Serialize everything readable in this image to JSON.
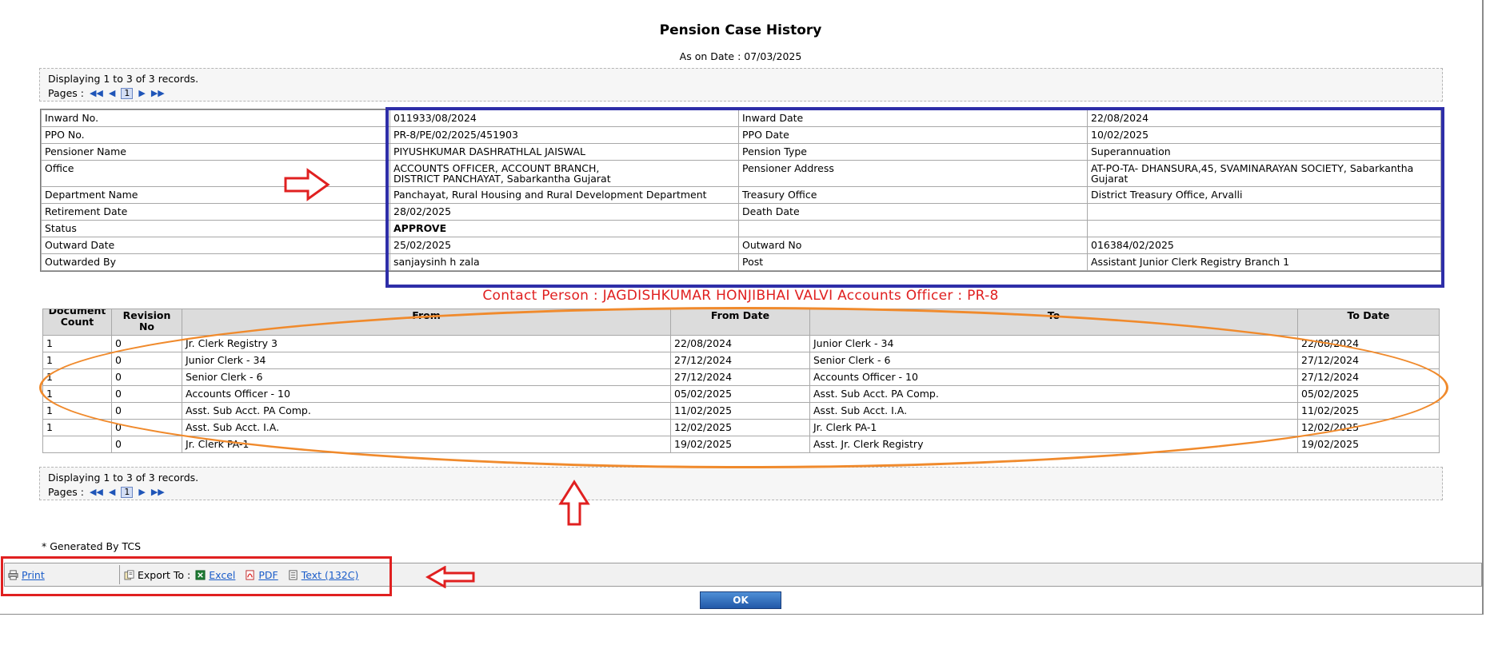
{
  "title": "Pension Case History",
  "as_on_date": "As on Date : 07/03/2025",
  "pager": {
    "records_text": "Displaying 1 to 3 of 3 records.",
    "pages_label": "Pages :",
    "current_page": "1"
  },
  "info_rows": [
    {
      "label1": "Inward No.",
      "value1": "011933/08/2024",
      "label2": "Inward Date",
      "value2": "22/08/2024"
    },
    {
      "label1": "PPO No.",
      "value1": "PR-8/PE/02/2025/451903",
      "label2": "PPO Date",
      "value2": "10/02/2025"
    },
    {
      "label1": "Pensioner Name",
      "value1": "PIYUSHKUMAR DASHRATHLAL JAISWAL",
      "label2": "Pension Type",
      "value2": "Superannuation"
    },
    {
      "label1": "Office",
      "value1": "ACCOUNTS OFFICER, ACCOUNT BRANCH,\nDISTRICT PANCHAYAT, Sabarkantha Gujarat",
      "label2": "Pensioner Address",
      "value2": "AT-PO-TA- DHANSURA,45, SVAMINARAYAN SOCIETY, Sabarkantha\nGujarat"
    },
    {
      "label1": "Department Name",
      "value1": "Panchayat, Rural Housing and Rural Development Department",
      "label2": "Treasury Office",
      "value2": "District Treasury Office, Arvalli"
    },
    {
      "label1": "Retirement Date",
      "value1": "28/02/2025",
      "label2": "Death Date",
      "value2": ""
    },
    {
      "label1": "Status",
      "value1": "APPROVE",
      "label2": "",
      "value2": ""
    },
    {
      "label1": "Outward Date",
      "value1": "25/02/2025",
      "label2": "Outward No",
      "value2": "016384/02/2025"
    },
    {
      "label1": "Outwarded By",
      "value1": "sanjaysinh h zala",
      "label2": "Post",
      "value2": "Assistant Junior Clerk Registry Branch 1"
    }
  ],
  "contact_person": "Contact Person : JAGDISHKUMAR HONJIBHAI VALVI Accounts Officer : PR-8",
  "doc_headers": {
    "count_line1": "Document",
    "count_line2": "Count",
    "revision": "Revision No",
    "from": "From",
    "from_date": "From Date",
    "to": "To",
    "to_date": "To Date"
  },
  "doc_rows": [
    {
      "count": "1",
      "rev": "0",
      "from": "Jr. Clerk Registry 3",
      "from_date": "22/08/2024",
      "to": "Junior Clerk - 34",
      "to_date": "22/08/2024"
    },
    {
      "count": "1",
      "rev": "0",
      "from": "Junior Clerk - 34",
      "from_date": "27/12/2024",
      "to": "Senior Clerk - 6",
      "to_date": "27/12/2024"
    },
    {
      "count": "1",
      "rev": "0",
      "from": "Senior Clerk - 6",
      "from_date": "27/12/2024",
      "to": "Accounts Officer - 10",
      "to_date": "27/12/2024"
    },
    {
      "count": "1",
      "rev": "0",
      "from": "Accounts Officer - 10",
      "from_date": "05/02/2025",
      "to": "Asst. Sub Acct. PA Comp.",
      "to_date": "05/02/2025"
    },
    {
      "count": "1",
      "rev": "0",
      "from": "Asst. Sub Acct. PA Comp.",
      "from_date": "11/02/2025",
      "to": "Asst. Sub Acct. I.A.",
      "to_date": "11/02/2025"
    },
    {
      "count": "1",
      "rev": "0",
      "from": "Asst. Sub Acct. I.A.",
      "from_date": "12/02/2025",
      "to": "Jr. Clerk PA-1",
      "to_date": "12/02/2025"
    },
    {
      "count": "",
      "rev": "0",
      "from": "Jr. Clerk PA-1",
      "from_date": "19/02/2025",
      "to": "Asst. Jr. Clerk Registry",
      "to_date": "19/02/2025"
    }
  ],
  "generated_by": "* Generated By TCS",
  "footer": {
    "print": "Print",
    "export_to": "Export To :",
    "excel": "Excel",
    "pdf": "PDF",
    "text": "Text (132C)"
  },
  "ok_button": "OK",
  "icons": {
    "first": "first-page-icon",
    "prev": "prev-page-icon",
    "next": "next-page-icon",
    "last": "last-page-icon",
    "print": "printer-icon",
    "export": "export-icon",
    "excel": "excel-icon",
    "pdf": "pdf-icon",
    "text": "text-file-icon"
  },
  "colors": {
    "annotation_blue": "#2e2ea8",
    "annotation_orange": "#f08a2c",
    "annotation_red": "#e02020",
    "link_blue": "#1a5cc9"
  }
}
